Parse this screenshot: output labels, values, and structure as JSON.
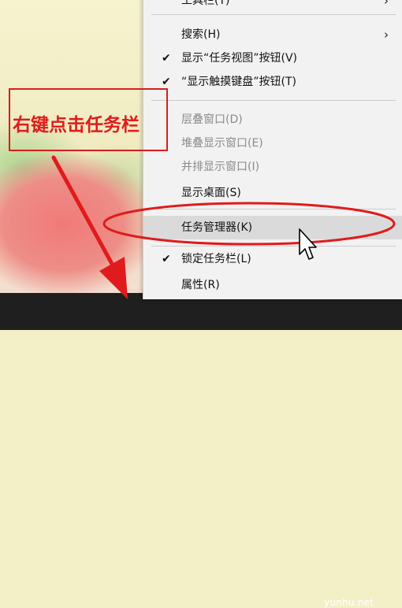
{
  "menu": {
    "items": [
      {
        "label": "工具栏(T)",
        "checked": false,
        "submenu": true,
        "disabled": false
      },
      {
        "label": "搜索(H)",
        "checked": false,
        "submenu": true,
        "disabled": false
      },
      {
        "label": "显示“任务视图”按钮(V)",
        "checked": true,
        "submenu": false,
        "disabled": false
      },
      {
        "label": "“显示触摸键盘”按钮(T)",
        "checked": true,
        "submenu": false,
        "disabled": false
      },
      {
        "label": "层叠窗口(D)",
        "checked": false,
        "submenu": false,
        "disabled": true
      },
      {
        "label": "堆叠显示窗口(E)",
        "checked": false,
        "submenu": false,
        "disabled": true
      },
      {
        "label": "并排显示窗口(I)",
        "checked": false,
        "submenu": false,
        "disabled": true
      },
      {
        "label": "显示桌面(S)",
        "checked": false,
        "submenu": false,
        "disabled": false
      },
      {
        "label": "任务管理器(K)",
        "checked": false,
        "submenu": false,
        "disabled": false,
        "highlighted": true
      },
      {
        "label": "锁定任务栏(L)",
        "checked": true,
        "submenu": false,
        "disabled": false
      },
      {
        "label": "属性(R)",
        "checked": false,
        "submenu": false,
        "disabled": false
      }
    ],
    "check_glyph": "✔",
    "submenu_glyph": "›"
  },
  "annotation": {
    "callout_text": "右键点击任务栏",
    "color": "#e01b1b"
  },
  "watermark": "yunhu.net",
  "colors": {
    "menu_bg": "#f2f2f2",
    "highlight_bg": "#dadada",
    "disabled_text": "#8b8b8b",
    "taskbar": "#1f1f1f"
  }
}
